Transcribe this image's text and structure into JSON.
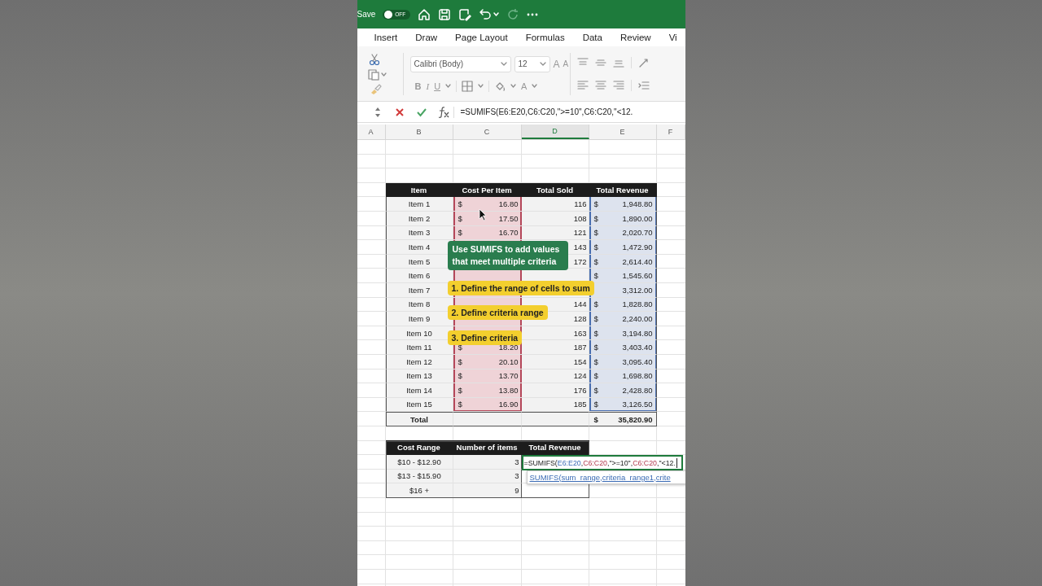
{
  "title_bar": {
    "autosave_label": "Save",
    "autosave": {
      "on": false,
      "label": "OFF"
    }
  },
  "tabs": [
    {
      "label": "Insert"
    },
    {
      "label": "Draw"
    },
    {
      "label": "Page Layout"
    },
    {
      "label": "Formulas"
    },
    {
      "label": "Data"
    },
    {
      "label": "Review"
    },
    {
      "label": "Vi"
    }
  ],
  "ribbon": {
    "font": "Calibri (Body)",
    "font_size": "12",
    "grow_label": "A",
    "shrink_label": "A",
    "format_buttons": [
      "B",
      "I",
      "U"
    ],
    "font_color_label": "A"
  },
  "formula_bar": {
    "formula": "=SUMIFS(E6:E20,C6:C20,\">=10\",C6:C20,\"<12."
  },
  "column_headers": [
    {
      "label": "A",
      "selected": false
    },
    {
      "label": "B",
      "selected": false
    },
    {
      "label": "C",
      "selected": false
    },
    {
      "label": "D",
      "selected": true
    },
    {
      "label": "E",
      "selected": false
    },
    {
      "label": "F",
      "selected": false
    }
  ],
  "table": {
    "columns": [
      "Item",
      "Cost Per Item",
      "Total Sold",
      "Total Revenue"
    ],
    "rows": [
      {
        "item": "Item 1",
        "cost_symbol": "$",
        "cost": "16.80",
        "sold": "116",
        "revenue_symbol": "$",
        "revenue": "1,948.80"
      },
      {
        "item": "Item 2",
        "cost_symbol": "$",
        "cost": "17.50",
        "sold": "108",
        "revenue_symbol": "$",
        "revenue": "1,890.00"
      },
      {
        "item": "Item 3",
        "cost_symbol": "$",
        "cost": "16.70",
        "sold": "121",
        "revenue_symbol": "$",
        "revenue": "2,020.70"
      },
      {
        "item": "Item 4",
        "sold": "143",
        "revenue_symbol": "$",
        "revenue": "1,472.90"
      },
      {
        "item": "Item 5",
        "sold": "172",
        "revenue_symbol": "$",
        "revenue": "2,614.40"
      },
      {
        "item": "Item 6",
        "revenue_symbol": "$",
        "revenue": "1,545.60"
      },
      {
        "item": "Item 7",
        "revenue": "3,312.00"
      },
      {
        "item": "Item 8",
        "sold": "144",
        "revenue_symbol": "$",
        "revenue": "1,828.80"
      },
      {
        "item": "Item 9",
        "sold": "128",
        "revenue_symbol": "$",
        "revenue": "2,240.00"
      },
      {
        "item": "Item 10",
        "sold": "163",
        "revenue_symbol": "$",
        "revenue": "3,194.80"
      },
      {
        "item": "Item 11",
        "cost_symbol": "$",
        "cost": "18.20",
        "sold": "187",
        "revenue_symbol": "$",
        "revenue": "3,403.40"
      },
      {
        "item": "Item 12",
        "cost_symbol": "$",
        "cost": "20.10",
        "sold": "154",
        "revenue_symbol": "$",
        "revenue": "3,095.40"
      },
      {
        "item": "Item 13",
        "cost_symbol": "$",
        "cost": "13.70",
        "sold": "124",
        "revenue_symbol": "$",
        "revenue": "1,698.80"
      },
      {
        "item": "Item 14",
        "cost_symbol": "$",
        "cost": "13.80",
        "sold": "176",
        "revenue_symbol": "$",
        "revenue": "2,428.80"
      },
      {
        "item": "Item 15",
        "cost_symbol": "$",
        "cost": "16.90",
        "sold": "185",
        "revenue_symbol": "$",
        "revenue": "3,126.50"
      }
    ],
    "total": {
      "label": "Total",
      "revenue_symbol": "$",
      "revenue": "35,820.90"
    }
  },
  "summary": {
    "columns": [
      "Cost Range",
      "Number of items",
      "Total Revenue"
    ],
    "rows": [
      {
        "range": "$10 - $12.90",
        "count": "3"
      },
      {
        "range": "$13 - $15.90",
        "count": "3"
      },
      {
        "range": "$16 +",
        "count": "9"
      }
    ]
  },
  "cell_edit": {
    "segments": [
      {
        "text": "=SUMIFS(",
        "kind": "plain"
      },
      {
        "text": "E6:E20",
        "kind": "sumref"
      },
      {
        "text": ",",
        "kind": "plain"
      },
      {
        "text": "C6:C20",
        "kind": "critref"
      },
      {
        "text": ",\">=10\",",
        "kind": "plain"
      },
      {
        "text": "C6:C20",
        "kind": "critref"
      },
      {
        "text": ",\"<12.",
        "kind": "plain"
      }
    ],
    "tooltip_function": "SUMIFS(",
    "tooltip_args": [
      "sum_range",
      ", ",
      "criteria_range1",
      ", ",
      "crite"
    ]
  },
  "callouts": [
    {
      "kind": "note",
      "text": "Use SUMIFS to add values that meet multiple criteria"
    },
    {
      "kind": "step",
      "text": "1. Define the range of cells to sum"
    },
    {
      "kind": "step",
      "text": "2. Define criteria range"
    },
    {
      "kind": "step",
      "text": "3. Define criteria"
    }
  ]
}
